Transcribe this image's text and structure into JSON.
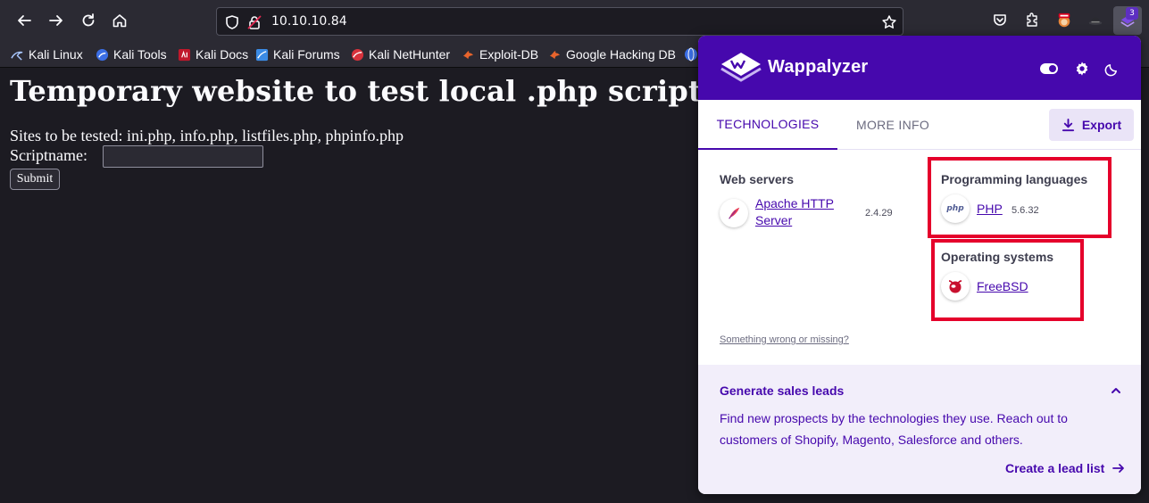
{
  "browser": {
    "url": "10.10.10.84",
    "extension_badge": "3",
    "bookmarks": [
      {
        "label": "Kali Linux"
      },
      {
        "label": "Kali Tools"
      },
      {
        "label": "Kali Docs"
      },
      {
        "label": "Kali Forums"
      },
      {
        "label": "Kali NetHunter"
      },
      {
        "label": "Exploit-DB"
      },
      {
        "label": "Google Hacking DB"
      }
    ]
  },
  "page": {
    "heading": "Temporary website to test local .php scripts",
    "sites_text": "Sites to be tested: ini.php, info.php, listfiles.php, phpinfo.php",
    "script_label": "Scriptname:",
    "script_value": "",
    "submit_label": "Submit"
  },
  "wappalyzer": {
    "title": "Wappalyzer",
    "tabs": {
      "technologies": "TECHNOLOGIES",
      "more_info": "MORE INFO"
    },
    "export_label": "Export",
    "categories": {
      "web_servers": {
        "title": "Web servers",
        "tech": {
          "name": "Apache HTTP Server",
          "version": "2.4.29",
          "icon": "apache-feather-icon"
        }
      },
      "programming_languages": {
        "title": "Programming languages",
        "tech": {
          "name": "PHP",
          "version": "5.6.32",
          "icon": "php-icon",
          "icon_text": "php"
        }
      },
      "operating_systems": {
        "title": "Operating systems",
        "tech": {
          "name": "FreeBSD",
          "version": "",
          "icon": "freebsd-icon"
        }
      }
    },
    "wrong_link": "Something wrong or missing?",
    "leads": {
      "title": "Generate sales leads",
      "text": "Find new prospects by the technologies they use. Reach out to customers of Shopify, Magento, Salesforce and others.",
      "cta": "Create a lead list"
    }
  },
  "colors": {
    "brand": "#4608ad",
    "highlight_box": "#e5002b",
    "page_bg": "#1c1b22"
  }
}
